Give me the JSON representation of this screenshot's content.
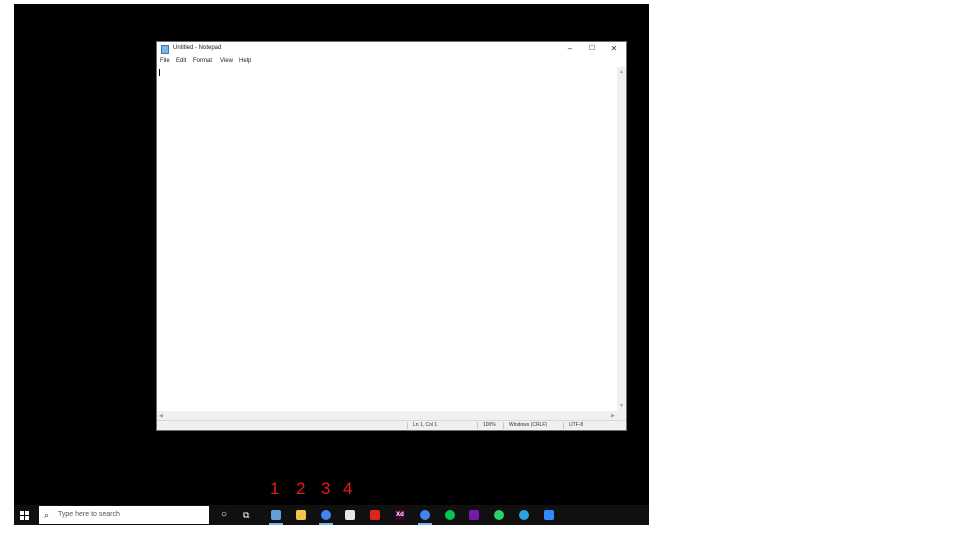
{
  "notepad": {
    "title": "Untitled - Notepad",
    "controls": {
      "minimize": "–",
      "maximize": "☐",
      "close": "✕"
    },
    "menu": [
      "File",
      "Edit",
      "Format",
      "View",
      "Help"
    ],
    "status": {
      "position": "Ln 1, Col 1",
      "zoom": "100%",
      "line_ending": "Windows (CRLF)",
      "encoding": "UTF-8"
    }
  },
  "taskbar": {
    "search_placeholder": "Type here to search",
    "apps": [
      {
        "name": "notepad",
        "color": "#5ea3db",
        "active": true
      },
      {
        "name": "file-explorer",
        "color": "#f4c54b",
        "active": false
      },
      {
        "name": "chrome",
        "color": "#4285f4",
        "active": true
      },
      {
        "name": "paint",
        "color": "#e6e6e6",
        "active": false
      },
      {
        "name": "acrobat",
        "color": "#e2231a",
        "active": false
      },
      {
        "name": "adobe-xd",
        "color": "#470137",
        "glyph": "Xd",
        "active": false
      },
      {
        "name": "chrome-2",
        "color": "#4285f4",
        "active": true
      },
      {
        "name": "line",
        "color": "#06c755",
        "active": false
      },
      {
        "name": "onenote",
        "color": "#7719aa",
        "active": false
      },
      {
        "name": "whatsapp",
        "color": "#25d366",
        "active": false
      },
      {
        "name": "telegram",
        "color": "#2aa3de",
        "active": false
      },
      {
        "name": "zoom",
        "color": "#2d8cff",
        "active": false
      }
    ]
  },
  "badges": [
    "1",
    "2",
    "3",
    "4"
  ]
}
